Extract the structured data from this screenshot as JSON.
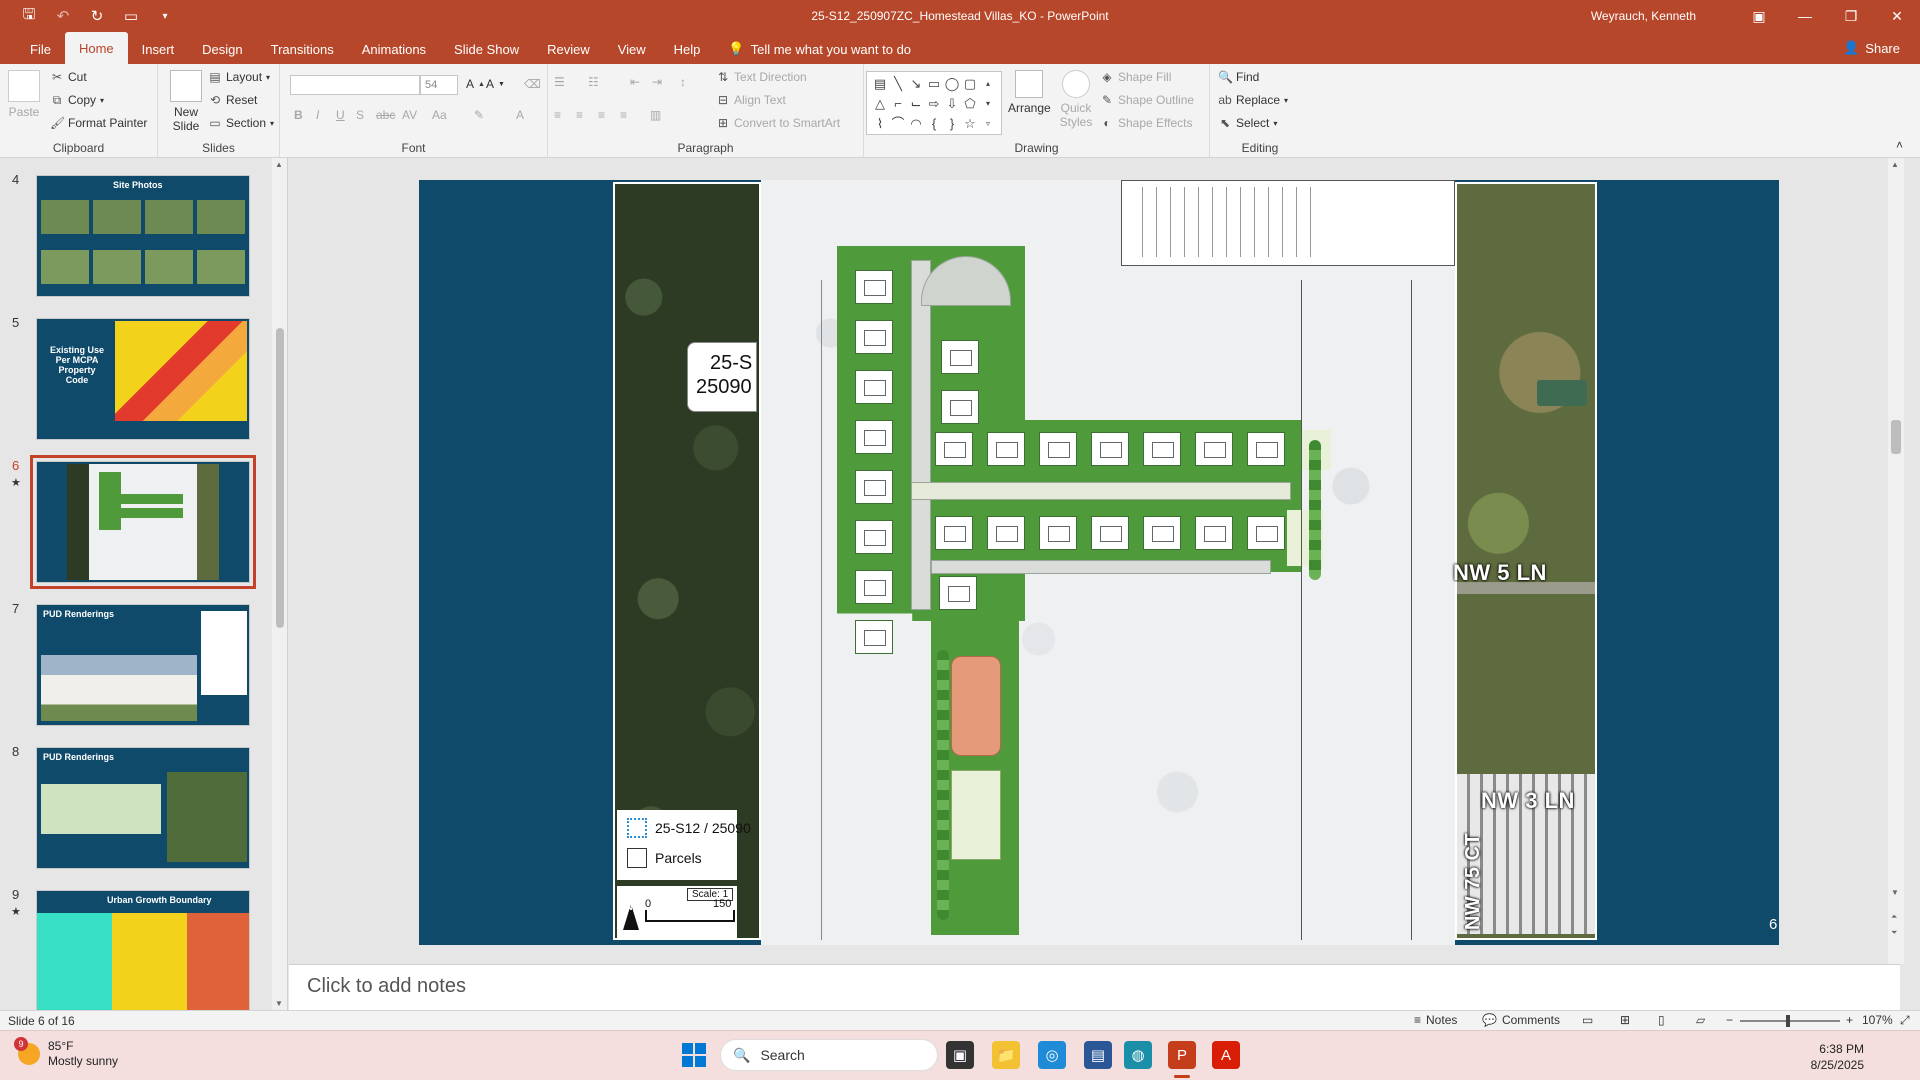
{
  "window": {
    "title": "25-S12_250907ZC_Homestead Villas_KO  -  PowerPoint",
    "user": "Weyrauch, Kenneth"
  },
  "tabs": [
    "File",
    "Home",
    "Insert",
    "Design",
    "Transitions",
    "Animations",
    "Slide Show",
    "Review",
    "View",
    "Help"
  ],
  "tellme": "Tell me what you want to do",
  "share": "Share",
  "ribbon": {
    "clipboard": {
      "label": "Clipboard",
      "paste": "Paste",
      "cut": "Cut",
      "copy": "Copy",
      "format_painter": "Format Painter"
    },
    "slides": {
      "label": "Slides",
      "new_slide": "New Slide",
      "layout": "Layout",
      "reset": "Reset",
      "section": "Section"
    },
    "font": {
      "label": "Font",
      "size": "54"
    },
    "paragraph": {
      "label": "Paragraph",
      "text_direction": "Text Direction",
      "align_text": "Align Text",
      "convert_smartart": "Convert to SmartArt"
    },
    "drawing": {
      "label": "Drawing",
      "arrange": "Arrange",
      "quick_styles": "Quick Styles",
      "shape_fill": "Shape Fill",
      "shape_outline": "Shape Outline",
      "shape_effects": "Shape Effects"
    },
    "editing": {
      "label": "Editing",
      "find": "Find",
      "replace": "Replace",
      "select": "Select"
    }
  },
  "thumbnails": [
    {
      "num": "4",
      "title": "Site Photos",
      "star": ""
    },
    {
      "num": "5",
      "title": "Existing Use Per MCPA Property Code",
      "star": ""
    },
    {
      "num": "6",
      "title": "",
      "star": "★"
    },
    {
      "num": "7",
      "title": "PUD Renderings",
      "star": ""
    },
    {
      "num": "8",
      "title": "PUD Renderings",
      "star": ""
    },
    {
      "num": "9",
      "title": "Urban Growth Boundary",
      "star": "★"
    }
  ],
  "slide": {
    "site_label_line1": "25-S",
    "site_label_line2": "25090",
    "legend_case": "25-S12 / 25090",
    "legend_parcels": "Parcels",
    "scale_label": "Scale: 1",
    "scale_zero": "0",
    "scale_150": "150",
    "north": "N",
    "roads": [
      "NW 5 LN",
      "NW 3 LN",
      "NW 75 CT"
    ],
    "number": "6"
  },
  "notes": "Click to add notes",
  "status": {
    "slide": "Slide 6 of 16",
    "notes": "Notes",
    "comments": "Comments",
    "zoom": "107%"
  },
  "taskbar": {
    "weather_temp": "85°F",
    "weather_desc": "Mostly sunny",
    "weather_badge": "9",
    "search": "Search",
    "time": "6:38 PM",
    "date": "8/25/2025"
  }
}
